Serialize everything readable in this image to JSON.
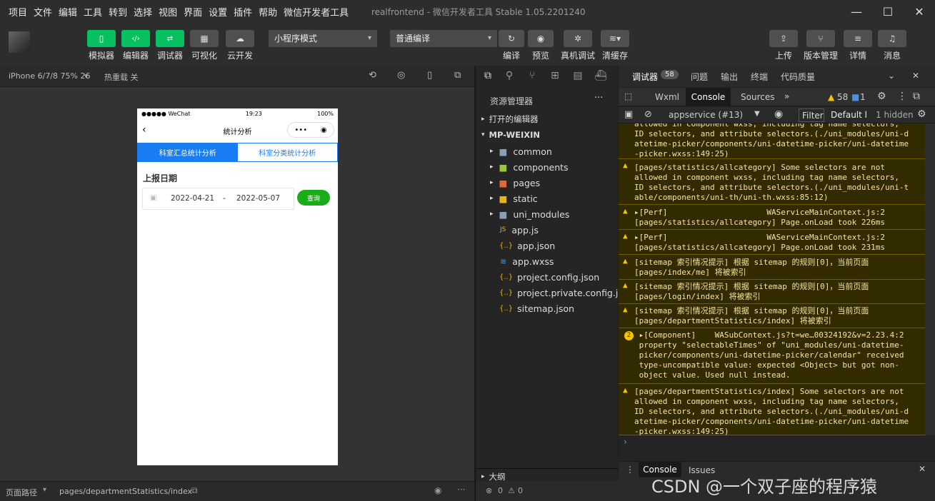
{
  "menu": [
    "项目",
    "文件",
    "编辑",
    "工具",
    "转到",
    "选择",
    "视图",
    "界面",
    "设置",
    "插件",
    "帮助",
    "微信开发者工具"
  ],
  "window_title": "realfrontend - 微信开发者工具 Stable 1.05.2201240",
  "toolbar": {
    "simulator": "模拟器",
    "editor": "编辑器",
    "debugger": "调试器",
    "visual": "可视化",
    "cloud": "云开发",
    "mode_select": "小程序模式",
    "compile_select": "普通编译",
    "compile": "编译",
    "preview": "预览",
    "real_debug": "真机调试",
    "clear_cache": "清缓存",
    "upload": "上传",
    "version": "版本管理",
    "detail": "详情",
    "message": "消息"
  },
  "sim": {
    "device": "iPhone 6/7/8 75% 26",
    "hot_reload": "热重载 关",
    "status_carrier": "●●●●● WeChat",
    "status_time": "19:23",
    "status_battery": "100%",
    "nav_title": "统计分析",
    "tab_active": "科室汇总统计分析",
    "tab_other": "科室分类统计分析",
    "section_label": "上报日期",
    "date_start": "2022-04-21",
    "date_sep": "-",
    "date_end": "2022-05-07",
    "query_button": "查询"
  },
  "bottom": {
    "path_label": "页面路径",
    "path": "pages/departmentStatistics/index"
  },
  "files": {
    "title": "资源管理器",
    "open_editors": "打开的编辑器",
    "root": "MP-WEIXIN",
    "items": [
      "common",
      "components",
      "pages",
      "static",
      "uni_modules",
      "app.js",
      "app.json",
      "app.wxss",
      "project.config.json",
      "project.private.config.js...",
      "sitemap.json"
    ],
    "outline": "大纲",
    "errors": "0",
    "warnings": "0"
  },
  "devtools": {
    "tab_debugger": "调试器",
    "badge": "58",
    "tab_issues": "问题",
    "tab_output": "输出",
    "tab_terminal": "终端",
    "tab_quality": "代码质量",
    "sub_wxml": "Wxml",
    "sub_console": "Console",
    "sub_sources": "Sources",
    "warn_count": "58",
    "info_count": "1",
    "context": "appservice (#13)",
    "filter": "Filter",
    "levels": "Default l",
    "hidden": "1 hidden",
    "drawer_console": "Console",
    "drawer_issues": "Issues"
  },
  "console_messages": [
    {
      "text": "allowed in component wxss, including tag name selectors,\nID selectors, and attribute selectors.(./uni_modules/uni-d\natetime-picker/components/uni-datetime-picker/uni-datetime\n-picker.wxss:149:25)"
    },
    {
      "text": "[pages/statistics/allcategory] Some selectors are not\nallowed in component wxss, including tag name selectors,\nID selectors, and attribute selectors.(./uni_modules/uni-t\nable/components/uni-th/uni-th.wxss:85:12)"
    },
    {
      "text": "▸[Perf]                     WAServiceMainContext.js:2\n[pages/statistics/allcategory] Page.onLoad took 226ms"
    },
    {
      "text": "▸[Perf]                     WAServiceMainContext.js:2\n[pages/statistics/allcategory] Page.onLoad took 231ms"
    },
    {
      "text": "[sitemap 索引情况提示] 根据 sitemap 的规则[0]，当前页面\n[pages/index/me] 将被索引"
    },
    {
      "text": "[sitemap 索引情况提示] 根据 sitemap 的规则[0]，当前页面\n[pages/login/index] 将被索引"
    },
    {
      "text": "[sitemap 索引情况提示] 根据 sitemap 的规则[0]，当前页面\n[pages/departmentStatistics/index] 将被索引"
    },
    {
      "text": " ▸[Component]    WASubContext.js?t=we…00324192&v=2.23.4:2\n property \"selectableTimes\" of \"uni_modules/uni-datetime-\n picker/components/uni-datetime-picker/calendar\" received\n type-uncompatible value: expected <Object> but got non-\n object value. Used null instead."
    },
    {
      "text": "[pages/departmentStatistics/index] Some selectors are not\nallowed in component wxss, including tag name selectors,\nID selectors, and attribute selectors.(./uni_modules/uni-d\natetime-picker/components/uni-datetime-picker/uni-datetime\n-picker.wxss:149:25)"
    }
  ],
  "watermark": "CSDN @一个双子座的程序猿",
  "colors": {
    "accent": "#07c160",
    "tab_blue": "#1a7cf2",
    "warn_bg": "#332b00",
    "warn_text": "#f5e4a0"
  }
}
